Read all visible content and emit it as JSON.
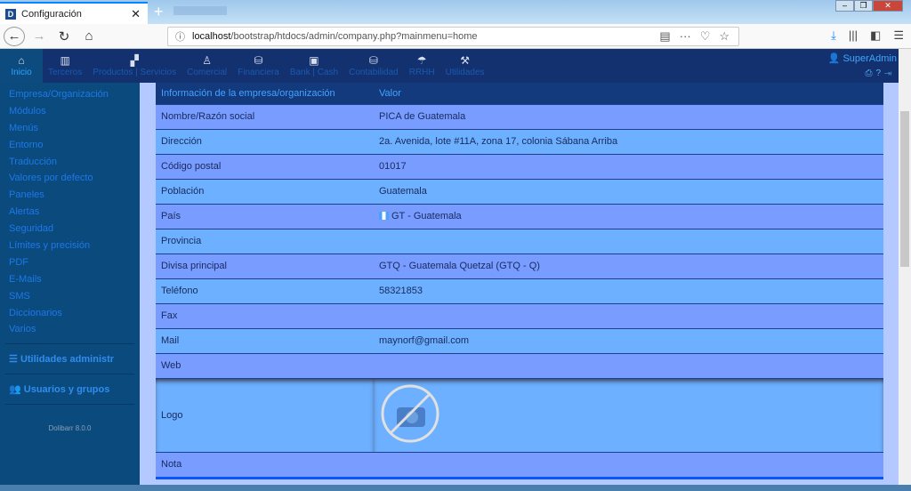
{
  "browser": {
    "tab_title": "Configuración",
    "url_host": "localhost",
    "url_path": "/bootstrap/htdocs/admin/company.php?mainmenu=home"
  },
  "topmenu": [
    {
      "label": "Inicio",
      "icon": "home-icon"
    },
    {
      "label": "Terceros",
      "icon": "building-icon"
    },
    {
      "label": "Productos | Servicios",
      "icon": "cubes-icon"
    },
    {
      "label": "Comercial",
      "icon": "tie-icon"
    },
    {
      "label": "Financiera",
      "icon": "coins-icon"
    },
    {
      "label": "Bank | Cash",
      "icon": "safe-icon"
    },
    {
      "label": "Contabilidad",
      "icon": "coins-icon"
    },
    {
      "label": "RRHH",
      "icon": "umbrella-icon"
    },
    {
      "label": "Utilidades",
      "icon": "tools-icon"
    }
  ],
  "user": {
    "name": "SuperAdmin"
  },
  "sidebar": {
    "items": [
      "Empresa/Organización",
      "Módulos",
      "Menús",
      "Entorno",
      "Traducción",
      "Valores por defecto",
      "Paneles",
      "Alertas",
      "Seguridad",
      "Límites y precisión",
      "PDF",
      "E-Mails",
      "SMS",
      "Diccionarios",
      "Varios"
    ],
    "section1": "Utilidades administr",
    "section2": "Usuarios y grupos",
    "version": "Dolibarr 8.0.0"
  },
  "table": {
    "headers": [
      "Información de la empresa/organización",
      "Valor"
    ],
    "rows": [
      [
        "Nombre/Razón social",
        "PICA de Guatemala"
      ],
      [
        "Dirección",
        "2a. Avenida, lote #11A, zona 17, colonia Sábana Arriba"
      ],
      [
        "Código postal",
        "01017"
      ],
      [
        "Población",
        "Guatemala"
      ],
      [
        "País",
        "GT - Guatemala"
      ],
      [
        "Provincia",
        ""
      ],
      [
        "Divisa principal",
        "GTQ - Guatemala Quetzal (GTQ - Q)"
      ],
      [
        "Teléfono",
        "58321853"
      ],
      [
        "Fax",
        ""
      ],
      [
        "Mail",
        "maynorf@gmail.com"
      ],
      [
        "Web",
        ""
      ],
      [
        "Logo",
        ""
      ],
      [
        "Nota",
        ""
      ]
    ]
  }
}
